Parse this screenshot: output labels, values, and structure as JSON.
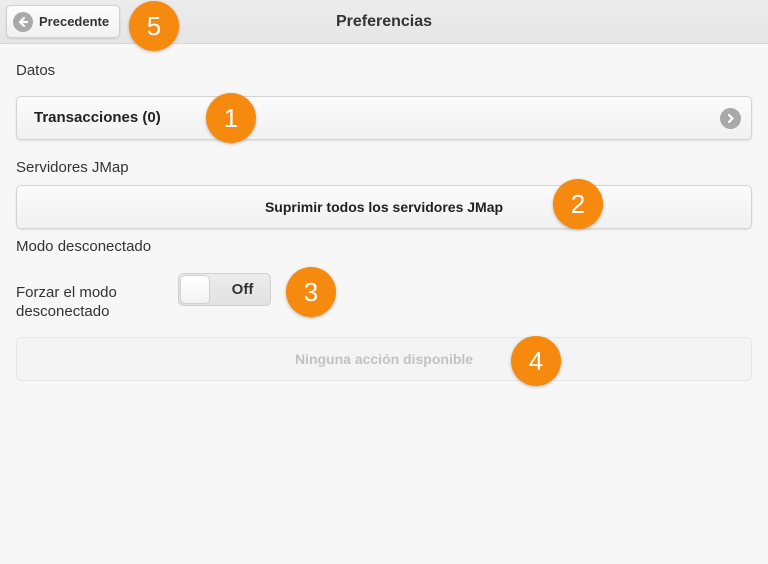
{
  "header": {
    "title": "Preferencias",
    "back_label": "Precedente"
  },
  "sections": {
    "data_label": "Datos",
    "jmap_label": "Servidores JMap",
    "offline_label": "Modo desconectado"
  },
  "transactions_button": {
    "label": "Transacciones (0)",
    "icon": "chevron-right-icon"
  },
  "delete_servers_button": {
    "label": "Suprimir todos los servidores JMap"
  },
  "offline_toggle": {
    "label": "Forzar el modo desconectado",
    "state": "Off"
  },
  "no_action_button": {
    "label": "Ninguna acción disponible"
  },
  "callouts": {
    "c1": "1",
    "c2": "2",
    "c3": "3",
    "c4": "4",
    "c5": "5"
  },
  "colors": {
    "callout": "#f68a0e",
    "icon_gray": "#a9a9a9",
    "background": "#f7f7f7"
  }
}
